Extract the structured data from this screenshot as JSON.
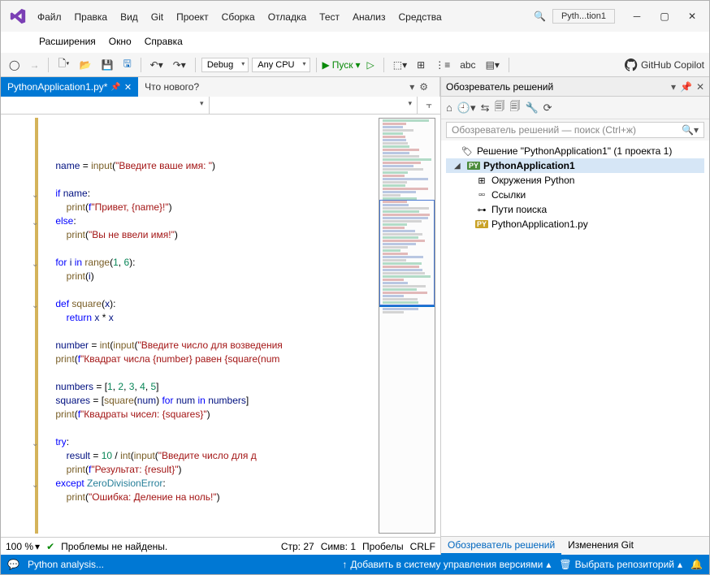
{
  "window": {
    "title": "Pyth...tion1"
  },
  "menu": {
    "row1": [
      "Файл",
      "Правка",
      "Вид",
      "Git",
      "Проект",
      "Сборка",
      "Отладка",
      "Тест",
      "Анализ",
      "Средства"
    ],
    "row2": [
      "Расширения",
      "Окно",
      "Справка"
    ]
  },
  "toolbar": {
    "config": "Debug",
    "platform": "Any CPU",
    "run": "Пуск",
    "copilot": "GitHub Copilot"
  },
  "editor": {
    "tab_active": "PythonApplication1.py*",
    "tab_other": "Что нового?",
    "code_lines": [
      {
        "indent": 1,
        "tokens": [
          [
            "id",
            "name"
          ],
          [
            "",
            " = "
          ],
          [
            "fn",
            "input"
          ],
          [
            "",
            "("
          ],
          [
            "str",
            "\"Введите ваше имя: \""
          ],
          [
            "",
            ")"
          ]
        ]
      },
      {
        "indent": 0,
        "blank": true
      },
      {
        "indent": 1,
        "fold": true,
        "tokens": [
          [
            "kw",
            "if"
          ],
          [
            "",
            " "
          ],
          [
            "id",
            "name"
          ],
          [
            "",
            ":"
          ]
        ]
      },
      {
        "indent": 2,
        "tokens": [
          [
            "fn",
            "print"
          ],
          [
            "",
            "("
          ],
          [
            "kw",
            "f"
          ],
          [
            "str",
            "\"Привет, {name}!\""
          ],
          [
            "",
            ")"
          ]
        ]
      },
      {
        "indent": 1,
        "fold": true,
        "tokens": [
          [
            "kw",
            "else"
          ],
          [
            "",
            ":"
          ]
        ]
      },
      {
        "indent": 2,
        "tokens": [
          [
            "fn",
            "print"
          ],
          [
            "",
            "("
          ],
          [
            "str",
            "\"Вы не ввели имя!\""
          ],
          [
            "",
            ")"
          ]
        ]
      },
      {
        "indent": 0,
        "blank": true
      },
      {
        "indent": 1,
        "fold": true,
        "tokens": [
          [
            "kw",
            "for"
          ],
          [
            "",
            " "
          ],
          [
            "id",
            "i"
          ],
          [
            "",
            " "
          ],
          [
            "kw",
            "in"
          ],
          [
            "",
            " "
          ],
          [
            "fn",
            "range"
          ],
          [
            "",
            "("
          ],
          [
            "num",
            "1"
          ],
          [
            "",
            ", "
          ],
          [
            "num",
            "6"
          ],
          [
            "",
            "):"
          ]
        ]
      },
      {
        "indent": 2,
        "tokens": [
          [
            "fn",
            "print"
          ],
          [
            "",
            "("
          ],
          [
            "id",
            "i"
          ],
          [
            "",
            ")"
          ]
        ]
      },
      {
        "indent": 0,
        "blank": true
      },
      {
        "indent": 1,
        "fold": true,
        "tokens": [
          [
            "kw",
            "def"
          ],
          [
            "",
            " "
          ],
          [
            "fn",
            "square"
          ],
          [
            "",
            "("
          ],
          [
            "id",
            "x"
          ],
          [
            "",
            "):"
          ]
        ]
      },
      {
        "indent": 2,
        "tokens": [
          [
            "kw",
            "return"
          ],
          [
            "",
            " "
          ],
          [
            "id",
            "x"
          ],
          [
            "",
            " * "
          ],
          [
            "id",
            "x"
          ]
        ]
      },
      {
        "indent": 0,
        "blank": true
      },
      {
        "indent": 1,
        "tokens": [
          [
            "id",
            "number"
          ],
          [
            "",
            " = "
          ],
          [
            "fn",
            "int"
          ],
          [
            "",
            "("
          ],
          [
            "fn",
            "input"
          ],
          [
            "",
            "("
          ],
          [
            "str",
            "\"Введите число для возведения"
          ]
        ]
      },
      {
        "indent": 1,
        "tokens": [
          [
            "fn",
            "print"
          ],
          [
            "",
            "("
          ],
          [
            "kw",
            "f"
          ],
          [
            "str",
            "\"Квадрат числа {number} равен {square(num"
          ]
        ]
      },
      {
        "indent": 0,
        "blank": true
      },
      {
        "indent": 1,
        "tokens": [
          [
            "id",
            "numbers"
          ],
          [
            "",
            " = ["
          ],
          [
            "num",
            "1"
          ],
          [
            "",
            ", "
          ],
          [
            "num",
            "2"
          ],
          [
            "",
            ", "
          ],
          [
            "num",
            "3"
          ],
          [
            "",
            ", "
          ],
          [
            "num",
            "4"
          ],
          [
            "",
            ", "
          ],
          [
            "num",
            "5"
          ],
          [
            "",
            "]"
          ]
        ]
      },
      {
        "indent": 1,
        "tokens": [
          [
            "id",
            "squares"
          ],
          [
            "",
            " = ["
          ],
          [
            "fn",
            "square"
          ],
          [
            "",
            "("
          ],
          [
            "id",
            "num"
          ],
          [
            "",
            ") "
          ],
          [
            "kw",
            "for"
          ],
          [
            "",
            " "
          ],
          [
            "id",
            "num"
          ],
          [
            "",
            " "
          ],
          [
            "kw",
            "in"
          ],
          [
            "",
            " "
          ],
          [
            "id",
            "numbers"
          ],
          [
            "",
            "]"
          ]
        ]
      },
      {
        "indent": 1,
        "tokens": [
          [
            "fn",
            "print"
          ],
          [
            "",
            "("
          ],
          [
            "kw",
            "f"
          ],
          [
            "str",
            "\"Квадраты чисел: {squares}\""
          ],
          [
            "",
            ")"
          ]
        ]
      },
      {
        "indent": 0,
        "blank": true
      },
      {
        "indent": 1,
        "fold": true,
        "tokens": [
          [
            "kw",
            "try"
          ],
          [
            "",
            ":"
          ]
        ]
      },
      {
        "indent": 2,
        "tokens": [
          [
            "id",
            "result"
          ],
          [
            "",
            " = "
          ],
          [
            "num",
            "10"
          ],
          [
            "",
            " / "
          ],
          [
            "fn",
            "int"
          ],
          [
            "",
            "("
          ],
          [
            "fn",
            "input"
          ],
          [
            "",
            "("
          ],
          [
            "str",
            "\"Введите число для д"
          ]
        ]
      },
      {
        "indent": 2,
        "tokens": [
          [
            "fn",
            "print"
          ],
          [
            "",
            "("
          ],
          [
            "kw",
            "f"
          ],
          [
            "str",
            "\"Результат: {result}\""
          ],
          [
            "",
            ")"
          ]
        ]
      },
      {
        "indent": 1,
        "fold": true,
        "tokens": [
          [
            "kw",
            "except"
          ],
          [
            "",
            " "
          ],
          [
            "cls",
            "ZeroDivisionError"
          ],
          [
            "",
            ":"
          ]
        ]
      },
      {
        "indent": 2,
        "tokens": [
          [
            "fn",
            "print"
          ],
          [
            "",
            "("
          ],
          [
            "str",
            "\"Ошибка: Деление на ноль!\""
          ],
          [
            "",
            ")"
          ]
        ]
      },
      {
        "indent": 0,
        "blank": true
      }
    ]
  },
  "editor_status": {
    "zoom": "100 %",
    "problems": "Проблемы не найдены.",
    "line": "Стр: 27",
    "col": "Симв: 1",
    "indent": "Пробелы",
    "eol": "CRLF"
  },
  "solution_explorer": {
    "title": "Обозреватель решений",
    "search_placeholder": "Обозреватель решений — поиск (Ctrl+ж)",
    "solution_label": "Решение \"PythonApplication1\"  (1 проекта 1)",
    "project": "PythonApplication1",
    "env": "Окружения Python",
    "refs": "Ссылки",
    "paths": "Пути поиска",
    "file": "PythonApplication1.py"
  },
  "se_tabs": {
    "active": "Обозреватель решений",
    "other": "Изменения Git"
  },
  "statusbar": {
    "analysis": "Python analysis...",
    "source_control": "Добавить в систему управления версиями",
    "repo": "Выбрать репозиторий"
  }
}
